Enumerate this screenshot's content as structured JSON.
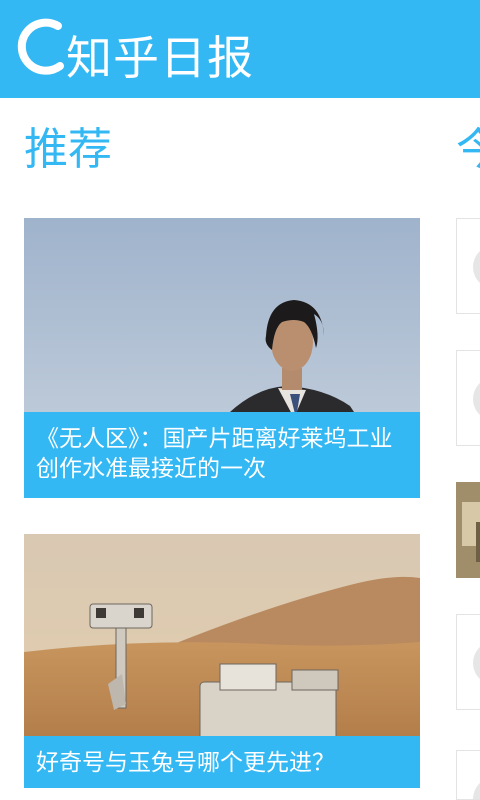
{
  "header": {
    "app_title": "知乎日报",
    "logo_icon": "zhihu-daily-logo-icon",
    "bar_color": "#33b8f4"
  },
  "sections": {
    "recommended_title": "推荐",
    "today_title_partial": "今"
  },
  "stories": [
    {
      "title": "《无人区》：国产片距离好莱坞工业创作水准最接近的一次",
      "image": "man-in-suit-against-sky-photo"
    },
    {
      "title": "好奇号与玉兔号哪个更先进？",
      "image": "mars-rover-selfie-photo"
    }
  ],
  "right_column": {
    "items": [
      "avatar-placeholder",
      "avatar-placeholder",
      "photo-thumbnail",
      "avatar-placeholder",
      "avatar-placeholder"
    ]
  },
  "colors": {
    "accent": "#33b8f4",
    "caption_text": "#ffffff"
  }
}
